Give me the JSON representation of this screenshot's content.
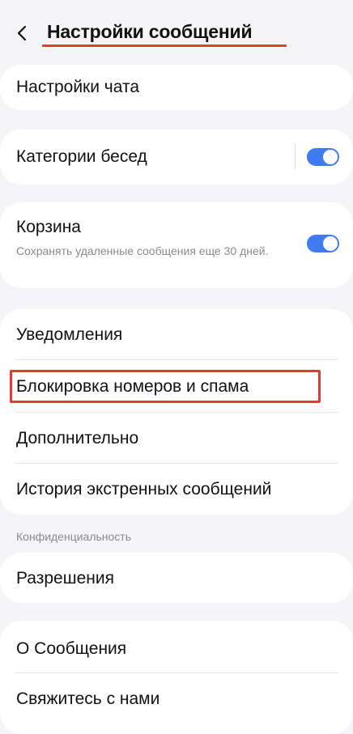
{
  "header": {
    "title": "Настройки сообщений"
  },
  "items": {
    "chat_settings": "Настройки чата",
    "conversation_categories": "Категории бесед",
    "trash": "Корзина",
    "trash_desc": "Сохранять удаленные сообщения еще 30 дней.",
    "notifications": "Уведомления",
    "block_numbers_spam": "Блокировка номеров и спама",
    "advanced": "Дополнительно",
    "emergency_history": "История экстренных сообщений",
    "privacy_section": "Конфиденциальность",
    "permissions": "Разрешения",
    "about": "О Сообщения",
    "contact_us": "Свяжитесь с нами"
  },
  "toggles": {
    "conversation_categories": "on",
    "trash": "on"
  },
  "colors": {
    "accent": "#3e7bf0",
    "annotation": "#e53935",
    "background": "#f5f5f7",
    "card": "#ffffff"
  },
  "icons": {
    "back": "chevron-left-icon"
  }
}
